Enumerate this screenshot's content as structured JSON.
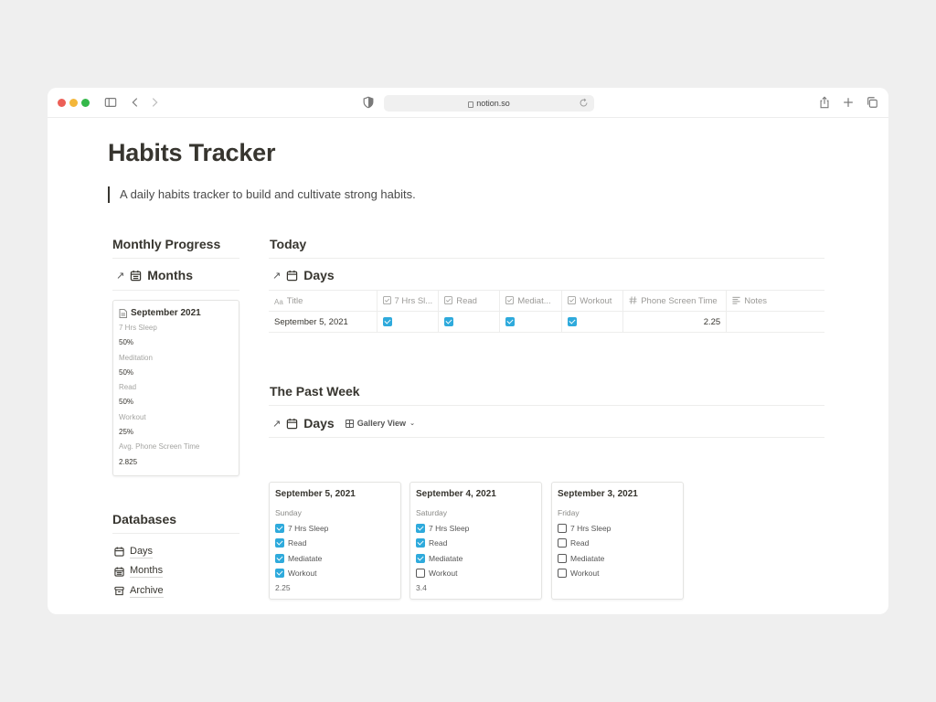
{
  "browser": {
    "url": "notion.so"
  },
  "page": {
    "title": "Habits Tracker",
    "quote": "A daily habits tracker to build and cultivate strong habits."
  },
  "monthly_progress": {
    "heading": "Monthly Progress",
    "db_title": "Months",
    "card": {
      "title": "September 2021",
      "props": [
        {
          "label": "7 Hrs Sleep",
          "value": "50%"
        },
        {
          "label": "Meditation",
          "value": "50%"
        },
        {
          "label": "Read",
          "value": "50%"
        },
        {
          "label": "Workout",
          "value": "25%"
        },
        {
          "label": "Avg. Phone Screen Time",
          "value": "2.825"
        }
      ]
    }
  },
  "databases": {
    "heading": "Databases",
    "items": [
      {
        "label": "Days",
        "icon": "calendar-icon"
      },
      {
        "label": "Months",
        "icon": "calendar-grid-icon"
      },
      {
        "label": "Archive",
        "icon": "archive-icon"
      }
    ]
  },
  "today": {
    "heading": "Today",
    "db_title": "Days",
    "columns": [
      {
        "label": "Title",
        "icon": "text-icon"
      },
      {
        "label": "7 Hrs Sl...",
        "icon": "checkbox-icon"
      },
      {
        "label": "Read",
        "icon": "checkbox-icon"
      },
      {
        "label": "Mediat...",
        "icon": "checkbox-icon"
      },
      {
        "label": "Workout",
        "icon": "checkbox-icon"
      },
      {
        "label": "Phone Screen Time",
        "icon": "number-icon"
      },
      {
        "label": "Notes",
        "icon": "lines-icon"
      }
    ],
    "rows": [
      {
        "title": "September 5, 2021",
        "sleep": true,
        "read": true,
        "meditate": true,
        "workout": true,
        "phone": "2.25",
        "notes": ""
      }
    ]
  },
  "past_week": {
    "heading": "The Past Week",
    "db_title": "Days",
    "view_label": "Gallery View",
    "cards": [
      {
        "date": "September 5, 2021",
        "day": "Sunday",
        "checks": [
          {
            "label": "7 Hrs Sleep",
            "checked": true
          },
          {
            "label": "Read",
            "checked": true
          },
          {
            "label": "Mediatate",
            "checked": true
          },
          {
            "label": "Workout",
            "checked": true
          }
        ],
        "phone": "2.25"
      },
      {
        "date": "September 4, 2021",
        "day": "Saturday",
        "checks": [
          {
            "label": "7 Hrs Sleep",
            "checked": true
          },
          {
            "label": "Read",
            "checked": true
          },
          {
            "label": "Mediatate",
            "checked": true
          },
          {
            "label": "Workout",
            "checked": false
          }
        ],
        "phone": "3.4"
      },
      {
        "date": "September 3, 2021",
        "day": "Friday",
        "checks": [
          {
            "label": "7 Hrs Sleep",
            "checked": false
          },
          {
            "label": "Read",
            "checked": false
          },
          {
            "label": "Mediatate",
            "checked": false
          },
          {
            "label": "Workout",
            "checked": false
          }
        ],
        "phone": ""
      }
    ]
  },
  "colors": {
    "checkbox_on": "#2eaadc",
    "text": "#37352f"
  }
}
